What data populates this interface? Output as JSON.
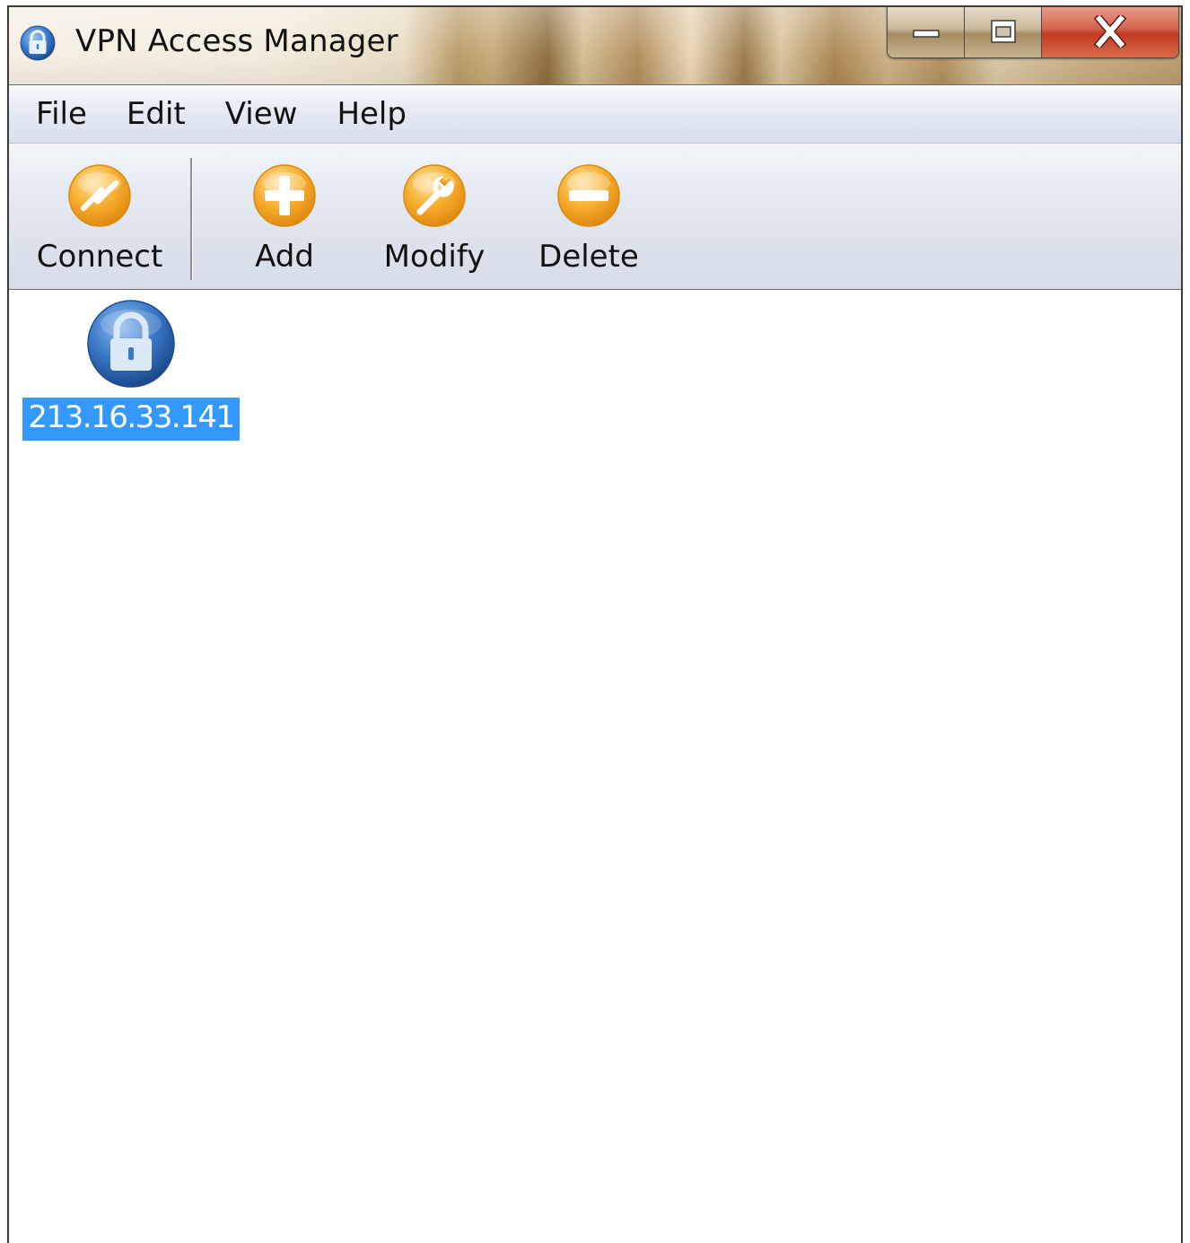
{
  "window": {
    "title": "VPN Access Manager",
    "app_icon": "lock-icon",
    "controls": {
      "minimize_icon": "minimize-icon",
      "maximize_icon": "maximize-icon",
      "close_icon": "close-icon"
    }
  },
  "menubar": {
    "items": [
      {
        "label": "File"
      },
      {
        "label": "Edit"
      },
      {
        "label": "View"
      },
      {
        "label": "Help"
      }
    ]
  },
  "toolbar": {
    "buttons": [
      {
        "label": "Connect",
        "icon": "connect-icon"
      },
      {
        "label": "Add",
        "icon": "plus-icon"
      },
      {
        "label": "Modify",
        "icon": "wrench-icon"
      },
      {
        "label": "Delete",
        "icon": "minus-icon"
      }
    ]
  },
  "connections": [
    {
      "label": "213.16.33.141",
      "icon": "lock-icon",
      "selected": true
    }
  ],
  "colors": {
    "selection": "#3399ff",
    "toolbar_icon": "#f5a623",
    "connection_icon": "#3a78c8"
  }
}
